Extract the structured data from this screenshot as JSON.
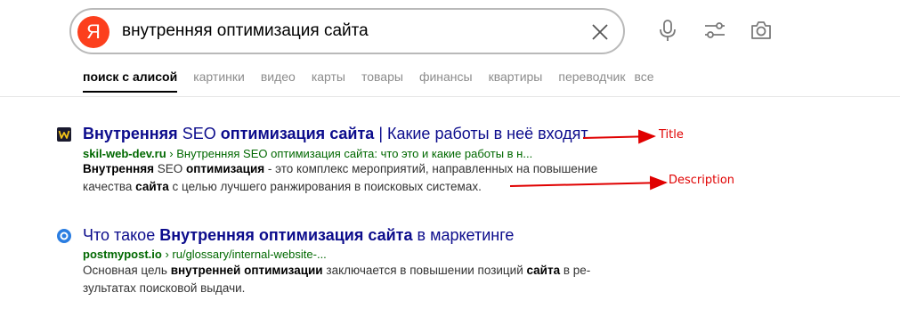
{
  "search": {
    "logo_letter": "Я",
    "query": "внутренняя оптимизация сайта",
    "clear_icon": "close-icon",
    "tool_icons": [
      "microphone-icon",
      "filters-icon",
      "camera-icon"
    ]
  },
  "tabs": [
    {
      "label": "поиск с алисой",
      "active": true
    },
    {
      "label": "картинки"
    },
    {
      "label": "видео"
    },
    {
      "label": "карты"
    },
    {
      "label": "товары"
    },
    {
      "label": "финансы"
    },
    {
      "label": "квартиры"
    },
    {
      "label": "переводчик"
    },
    {
      "label": "все"
    }
  ],
  "results": [
    {
      "favicon_icon": "w-favicon-icon",
      "title": {
        "p1": "Внутренняя",
        "p2": " SEO ",
        "p3": "оптимизация сайта",
        "p4": " | Какие работы в неё входят"
      },
      "url": {
        "host": "skil-web-dev.ru",
        "path": " › Внутренняя SEO оптимизация сайта: что это и какие работы в н..."
      },
      "desc": {
        "p1": "Внутренняя",
        "p2": " SEO ",
        "p3": "оптимизация",
        "p4": " - это комплекс мероприятий, направленных на повышение",
        "p5": "качества ",
        "p6": "сайта",
        "p7": " с целью лучшего ранжирования в поисковых системах."
      }
    },
    {
      "favicon_icon": "circle-favicon-icon",
      "title": {
        "p1": "Что такое ",
        "p2": "Внутренняя оптимизация сайта",
        "p3": " в маркетинге"
      },
      "url": {
        "host": "postmypost.io",
        "path": " › ru/glossary/internal-website-..."
      },
      "desc": {
        "p1": "Основная цель ",
        "p2": "внутренней оптимизации",
        "p3": " заключается в повышении позиций ",
        "p4": "сайта",
        "p5": " в ре-",
        "p6": "зультатах поисковой выдачи."
      }
    }
  ],
  "annotations": {
    "title_label": "Title",
    "description_label": "Description",
    "arrow_color": "#e00000"
  },
  "colors": {
    "title_link": "#0c0c8c",
    "url_green": "#006800",
    "logo_red": "#fc3f1d"
  }
}
